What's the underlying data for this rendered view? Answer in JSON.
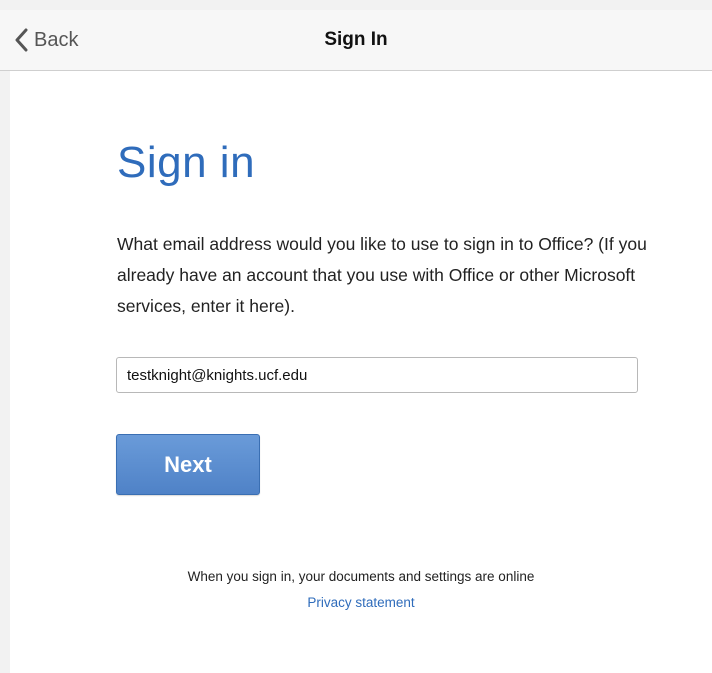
{
  "navbar": {
    "back_label": "Back",
    "title": "Sign In",
    "back_icon": "chevron-left-icon"
  },
  "main": {
    "heading": "Sign in",
    "description": "What email address would you like to use to sign in to Office? (If you already have an account that you use with Office or other Microsoft services, enter it here).",
    "email_value": "testknight@knights.ucf.edu",
    "next_label": "Next",
    "footer_note": "When you sign in, your documents and settings are online",
    "privacy_label": "Privacy statement"
  },
  "colors": {
    "accent": "#2f6cbb",
    "button": "#5a8ccf"
  }
}
